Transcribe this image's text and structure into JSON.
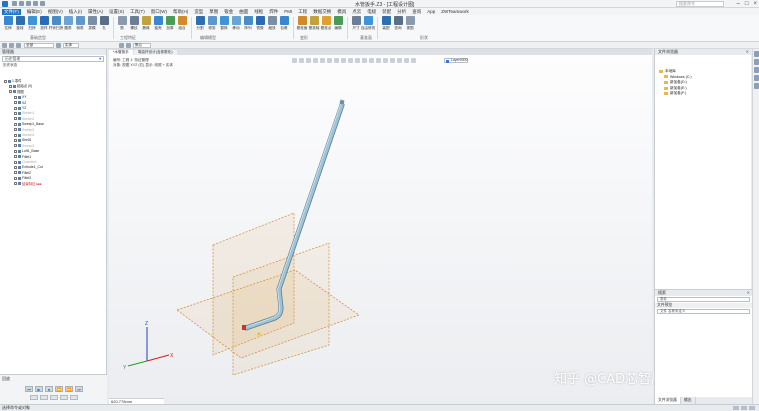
{
  "app": {
    "title": "水管扳手.Z3 - [工程设计图]",
    "search_placeholder": "搜索命令"
  },
  "menu_tabs": [
    "文件(F)",
    "编辑(E)",
    "视图(V)",
    "插入(I)",
    "属性(A)",
    "设置(S)",
    "工具(T)",
    "窗口(W)",
    "帮助(H)",
    "造型",
    "草图",
    "钣金",
    "曲面",
    "线框",
    "焊件",
    "PMI",
    "工程",
    "数据交换",
    "模具",
    "点云",
    "电极",
    "装配",
    "分析",
    "查询",
    "App",
    "ZWTeamwork"
  ],
  "active_menu_tab": 0,
  "ribbon": {
    "buttons": [
      {
        "label": "拉伸",
        "icon": "extrude-icon",
        "color": "#3a87d0"
      },
      {
        "label": "旋转",
        "icon": "revolve-icon",
        "color": "#2f6fb0"
      },
      {
        "label": "扫掠",
        "icon": "sweep-icon",
        "color": "#3f93d8"
      },
      {
        "label": "放样",
        "icon": "loft-icon",
        "color": "#2a6bb8"
      },
      {
        "label": "杆状扫掠",
        "icon": "rod-sweep-icon",
        "color": "#4a8cc8"
      },
      {
        "label": "圆角",
        "icon": "fillet-icon",
        "color": "#6aa3d6"
      },
      {
        "label": "倒角",
        "icon": "chamfer-icon",
        "color": "#5e97cc"
      },
      {
        "label": "拔模",
        "icon": "draft-icon",
        "color": "#7a8fa6"
      },
      {
        "label": "孔",
        "icon": "hole-icon",
        "color": "#5a6f88"
      },
      {
        "label": "筋",
        "icon": "rib-icon",
        "color": "#8a9bb0"
      },
      {
        "label": "螺纹",
        "icon": "thread-icon",
        "color": "#6c7e95"
      },
      {
        "label": "唇缘",
        "icon": "lip-icon",
        "color": "#c2a23c"
      },
      {
        "label": "抽壳",
        "icon": "shell-icon",
        "color": "#3a87d0"
      },
      {
        "label": "加厚",
        "icon": "thicken-icon",
        "color": "#4a9a58"
      },
      {
        "label": "组合",
        "icon": "combine-icon",
        "color": "#d38b2a"
      },
      {
        "label": "分割",
        "icon": "split-icon",
        "color": "#2f6fb0"
      },
      {
        "label": "修剪",
        "icon": "trim-icon",
        "color": "#5e97cc"
      },
      {
        "label": "替换",
        "icon": "replace-icon",
        "color": "#3f93d8"
      },
      {
        "label": "移动",
        "icon": "move-icon",
        "color": "#6aa3d6"
      },
      {
        "label": "阵列",
        "icon": "pattern-icon",
        "color": "#4a8cc8"
      },
      {
        "label": "镜像",
        "icon": "mirror-icon",
        "color": "#2a6bb8"
      },
      {
        "label": "缩放",
        "icon": "scale-icon",
        "color": "#7a8fa6"
      },
      {
        "label": "包裹",
        "icon": "wrap-icon",
        "color": "#3a87d0"
      },
      {
        "label": "基准面",
        "icon": "datum-plane-icon",
        "color": "#d38b2a"
      },
      {
        "label": "基准轴",
        "icon": "datum-axis-icon",
        "color": "#c2a23c"
      },
      {
        "label": "基准点",
        "icon": "datum-point-icon",
        "color": "#e0a030"
      },
      {
        "label": "编辑",
        "icon": "edit-icon",
        "color": "#4a9a58"
      },
      {
        "label": "尺寸",
        "icon": "dimension-icon",
        "color": "#6c7e95"
      },
      {
        "label": "自由修改",
        "icon": "freeform-icon",
        "color": "#3f93d8"
      },
      {
        "label": "装配",
        "icon": "assembly-icon",
        "color": "#2f6fb0"
      },
      {
        "label": "查询",
        "icon": "inquire-icon",
        "color": "#5a6f88"
      },
      {
        "label": "视图",
        "icon": "view-icon",
        "color": "#8a9bb0"
      }
    ],
    "groups": [
      "基础造型",
      "工程特征",
      "编辑模型",
      "变形",
      "基准面",
      "形状"
    ]
  },
  "subbar": {
    "filter_label": "全部",
    "mode_label": "实体",
    "view_label": "默认"
  },
  "left_panel": {
    "title": "管理器",
    "search_label": "历史管理",
    "tree_header": "历史状态",
    "items": [
      {
        "label": "1.零件",
        "state": "normal",
        "indent": 0
      },
      {
        "label": "起始点 (0)",
        "state": "normal",
        "indent": 1
      },
      {
        "label": "视图",
        "state": "normal",
        "indent": 1
      },
      {
        "label": "XY",
        "state": "normal",
        "indent": 2
      },
      {
        "label": "XZ",
        "state": "normal",
        "indent": 2
      },
      {
        "label": "YZ",
        "state": "normal",
        "indent": 2
      },
      {
        "label": "Sketch1",
        "state": "faded",
        "indent": 2
      },
      {
        "label": "Sketch2",
        "state": "faded",
        "indent": 2
      },
      {
        "label": "Sweep1_Base",
        "state": "normal",
        "indent": 2
      },
      {
        "label": "Sweep2",
        "state": "faded",
        "indent": 2
      },
      {
        "label": "Sketch3",
        "state": "faded",
        "indent": 2
      },
      {
        "label": "Shell1",
        "state": "normal",
        "indent": 2
      },
      {
        "label": "Sweep3",
        "state": "faded",
        "indent": 2
      },
      {
        "label": "Loft1_Base",
        "state": "normal",
        "indent": 2
      },
      {
        "label": "Fillet1",
        "state": "normal",
        "indent": 2
      },
      {
        "label": "Chamfer1",
        "state": "faded",
        "indent": 2
      },
      {
        "label": "Extrude1_Cut",
        "state": "normal",
        "indent": 2
      },
      {
        "label": "Fillet2",
        "state": "normal",
        "indent": 2
      },
      {
        "label": "Fillet3",
        "state": "normal",
        "indent": 2
      },
      {
        "label": "结束特征 ▸▸▸",
        "state": "red",
        "indent": 2
      }
    ],
    "bottom_title": "回放",
    "playback": [
      "⏮",
      "▶",
      "⏹",
      "⏪",
      "⏩",
      "⏭"
    ]
  },
  "doc_tabs": [
    "*水管扳手",
    "弯曲杆设计(含参数化)"
  ],
  "active_doc_tab": 0,
  "viewport": {
    "info_line1": "编号: 工程 1: 特征管理",
    "info_line2": "对象: 视图 XYZ (右) 显示: 线框 + 实体",
    "layer_label": "Layer0000",
    "scale_readout": "620.778mm",
    "watermark": "知乎 @CAD芯智库"
  },
  "right_panel": {
    "title": "文件浏览器",
    "close": "✕",
    "tree": [
      {
        "label": "本地库",
        "indent": 0
      },
      {
        "label": "Windows (C:)",
        "indent": 1
      },
      {
        "label": "新加卷(D:)",
        "indent": 1
      },
      {
        "label": "新加卷(E:)",
        "indent": 1
      },
      {
        "label": "新加卷(F:)",
        "indent": 1
      }
    ],
    "lower_title": "搜索",
    "lower_input": "零件",
    "lower_subhead": "文件预览",
    "lower_item": "文件 名称未定义",
    "tabs": [
      "文件浏览器",
      "输出"
    ],
    "active_tab": 0
  },
  "status": {
    "text": "选择命令或对象"
  }
}
